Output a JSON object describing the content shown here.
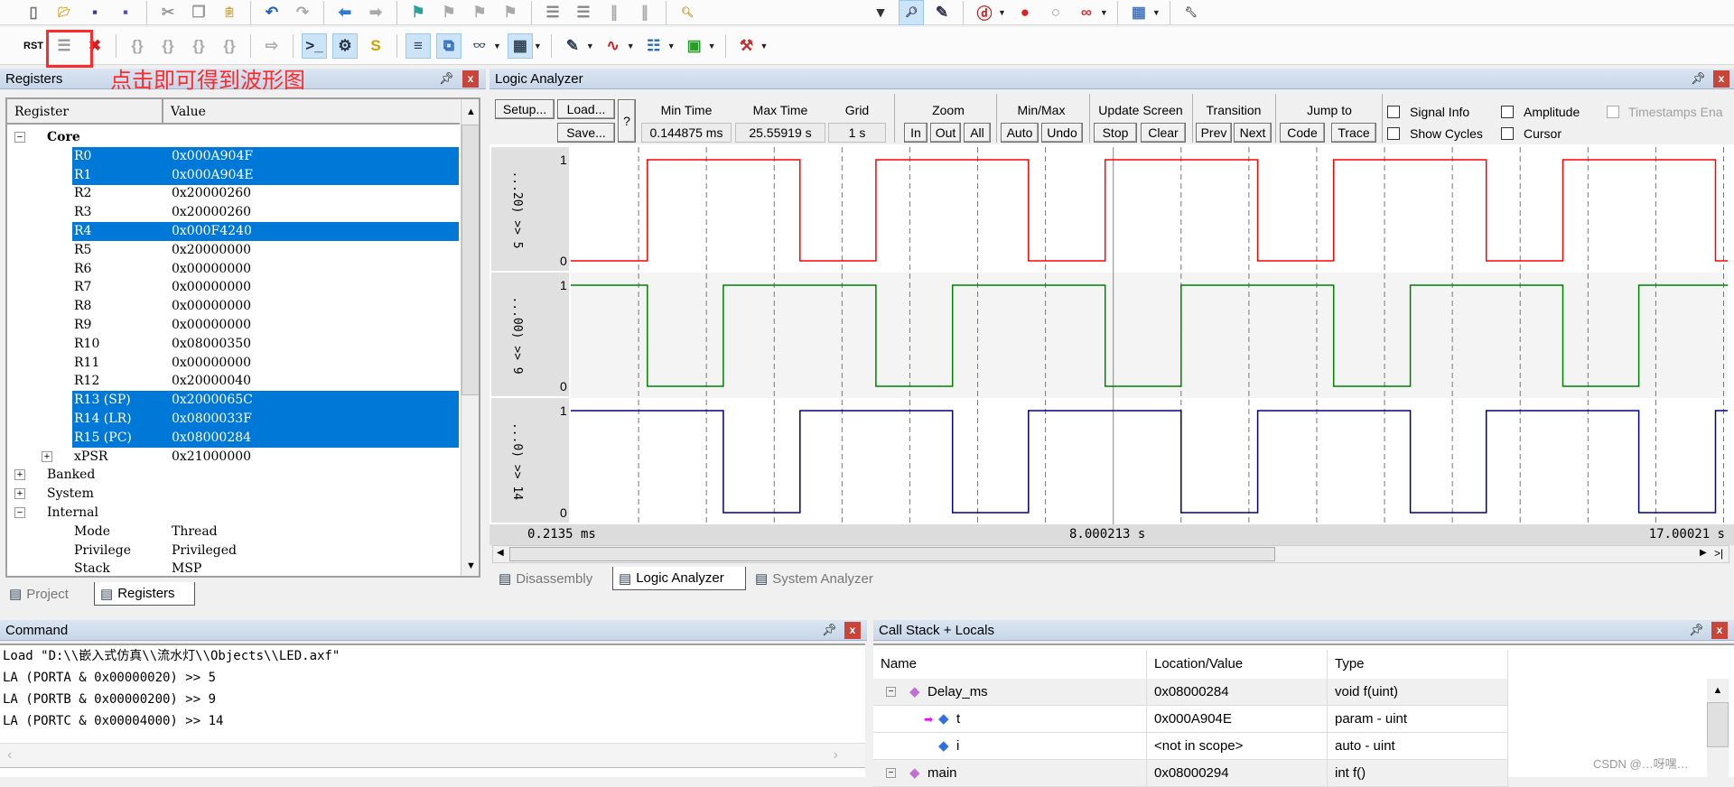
{
  "toolbar1": [
    "new-file",
    "open-folder",
    "save",
    "save-all",
    "|",
    "cut",
    "copy",
    "paste",
    "|",
    "undo",
    "redo",
    "|",
    "navigate-back",
    "navigate-forward",
    "|",
    "bookmark-insert",
    "bookmark-prev",
    "bookmark-next",
    "bookmark-clear",
    "|",
    "indent",
    "unindent",
    "comment",
    "uncomment",
    "|",
    "find-in-files"
  ],
  "toolbar1_right": [
    "dropdown",
    "find",
    "incremental-find",
    "|",
    "debug-start",
    "breakpoint-insert",
    "breakpoint-disable",
    "breakpoint-kill-all",
    "|",
    "window-layout",
    "|",
    "configure"
  ],
  "toolbar2": [
    "reset-cpu",
    "run",
    "stop-debug",
    "|",
    "step-into",
    "step-over",
    "step-out",
    "run-to-cursor",
    "|",
    "show-next-statement",
    "|",
    "command-window",
    "disassembly-window",
    "symbols-window",
    "|",
    "registers-window",
    "call-stack-window",
    "watch-window",
    "memory-window",
    "|",
    "serial-window",
    "analysis-window",
    "trace-window",
    "system-viewer",
    "|",
    "toolbox"
  ],
  "annotation": {
    "text": "点击即可得到波形图",
    "color": "#ff2a2a"
  },
  "registers": {
    "title": "Registers",
    "columns": [
      "Register",
      "Value"
    ],
    "rows": [
      {
        "name": "Core",
        "value": "",
        "level": 0,
        "expander": "minus",
        "bold": true
      },
      {
        "name": "R0",
        "value": "0x000A904F",
        "level": 1,
        "selected": true
      },
      {
        "name": "R1",
        "value": "0x000A904E",
        "level": 1,
        "selected": true
      },
      {
        "name": "R2",
        "value": "0x20000260",
        "level": 1
      },
      {
        "name": "R3",
        "value": "0x20000260",
        "level": 1
      },
      {
        "name": "R4",
        "value": "0x000F4240",
        "level": 1,
        "selected": true
      },
      {
        "name": "R5",
        "value": "0x20000000",
        "level": 1
      },
      {
        "name": "R6",
        "value": "0x00000000",
        "level": 1
      },
      {
        "name": "R7",
        "value": "0x00000000",
        "level": 1
      },
      {
        "name": "R8",
        "value": "0x00000000",
        "level": 1
      },
      {
        "name": "R9",
        "value": "0x00000000",
        "level": 1
      },
      {
        "name": "R10",
        "value": "0x08000350",
        "level": 1
      },
      {
        "name": "R11",
        "value": "0x00000000",
        "level": 1
      },
      {
        "name": "R12",
        "value": "0x20000040",
        "level": 1
      },
      {
        "name": "R13 (SP)",
        "value": "0x2000065C",
        "level": 1,
        "selected": true
      },
      {
        "name": "R14 (LR)",
        "value": "0x0800033F",
        "level": 1,
        "selected": true
      },
      {
        "name": "R15 (PC)",
        "value": "0x08000284",
        "level": 1,
        "selected": true
      },
      {
        "name": "xPSR",
        "value": "0x21000000",
        "level": 1,
        "expander": "plus"
      },
      {
        "name": "Banked",
        "value": "",
        "level": 0,
        "expander": "plus"
      },
      {
        "name": "System",
        "value": "",
        "level": 0,
        "expander": "plus"
      },
      {
        "name": "Internal",
        "value": "",
        "level": 0,
        "expander": "minus"
      },
      {
        "name": "Mode",
        "value": "Thread",
        "level": 1
      },
      {
        "name": "Privilege",
        "value": "Privileged",
        "level": 1
      },
      {
        "name": "Stack",
        "value": "MSP",
        "level": 1
      }
    ],
    "tabs": [
      {
        "label": "Project",
        "active": false
      },
      {
        "label": "Registers",
        "active": true
      }
    ]
  },
  "logic_analyzer": {
    "title": "Logic Analyzer",
    "buttons": {
      "setup": "Setup...",
      "load": "Load...",
      "save": "Save...",
      "help": "?"
    },
    "min_time": {
      "label": "Min Time",
      "value": "0.144875 ms"
    },
    "max_time": {
      "label": "Max Time",
      "value": "25.55919 s"
    },
    "grid": {
      "label": "Grid",
      "value": "1 s"
    },
    "zoom": {
      "label": "Zoom",
      "in": "In",
      "out": "Out",
      "all": "All"
    },
    "minmax": {
      "label": "Min/Max",
      "auto": "Auto",
      "undo": "Undo"
    },
    "update": {
      "label": "Update Screen",
      "stop": "Stop",
      "clear": "Clear"
    },
    "transition": {
      "label": "Transition",
      "prev": "Prev",
      "next": "Next"
    },
    "jump": {
      "label": "Jump to",
      "code": "Code",
      "trace": "Trace"
    },
    "checks": {
      "signal_info": "Signal Info",
      "show_cycles": "Show Cycles",
      "amplitude": "Amplitude",
      "cursor": "Cursor",
      "timestamps": "Timestamps Ena"
    },
    "time_labels": {
      "left": "0.2135 ms",
      "mid": "8.000213 s",
      "right": "17.00021 s"
    },
    "tabs": [
      {
        "label": "Disassembly",
        "active": false
      },
      {
        "label": "Logic Analyzer",
        "active": true
      },
      {
        "label": "System Analyzer",
        "active": false
      }
    ]
  },
  "chart_data": {
    "type": "line",
    "step": true,
    "xlim": [
      0,
      17.06
    ],
    "grid_interval_s": 1,
    "ylim": [
      0,
      1
    ],
    "series": [
      {
        "name": "...20) >> 5",
        "color": "#ff0000",
        "initial": 0,
        "transitions_s": [
          1.13,
          3.38,
          4.5,
          6.75,
          7.88,
          10.13,
          11.25,
          13.5,
          14.63,
          16.88
        ]
      },
      {
        "name": "...00) >> 9",
        "color": "#008000",
        "initial": 1,
        "transitions_s": [
          1.13,
          2.25,
          4.5,
          5.63,
          7.88,
          9.0,
          11.25,
          12.38,
          14.63,
          15.75
        ]
      },
      {
        "name": "...0) >> 14",
        "color": "#000080",
        "initial": 1,
        "transitions_s": [
          2.25,
          3.38,
          5.63,
          6.75,
          9.0,
          10.13,
          12.38,
          13.5,
          15.75,
          16.88
        ]
      }
    ]
  },
  "command": {
    "title": "Command",
    "lines": [
      "Load \"D:\\\\嵌入式仿真\\\\流水灯\\\\Objects\\\\LED.axf\"",
      "LA (PORTA & 0x00000020) >> 5",
      "LA (PORTB & 0x00000200) >> 9",
      "LA (PORTC & 0x00004000) >> 14"
    ]
  },
  "callstack": {
    "title": "Call Stack + Locals",
    "columns": [
      "Name",
      "Location/Value",
      "Type"
    ],
    "rows": [
      {
        "name": "Delay_ms",
        "value": "0x08000284",
        "type": "void f(uint)",
        "kind": "function",
        "level": 0
      },
      {
        "name": "t",
        "value": "0x000A904E",
        "type": "param - uint",
        "kind": "param",
        "level": 1
      },
      {
        "name": "i",
        "value": "<not in scope>",
        "type": "auto - uint",
        "kind": "local",
        "level": 1
      },
      {
        "name": "main",
        "value": "0x08000294",
        "type": "int f()",
        "kind": "function",
        "level": 0
      }
    ]
  },
  "watermark": "CSDN @…呀嘿…"
}
